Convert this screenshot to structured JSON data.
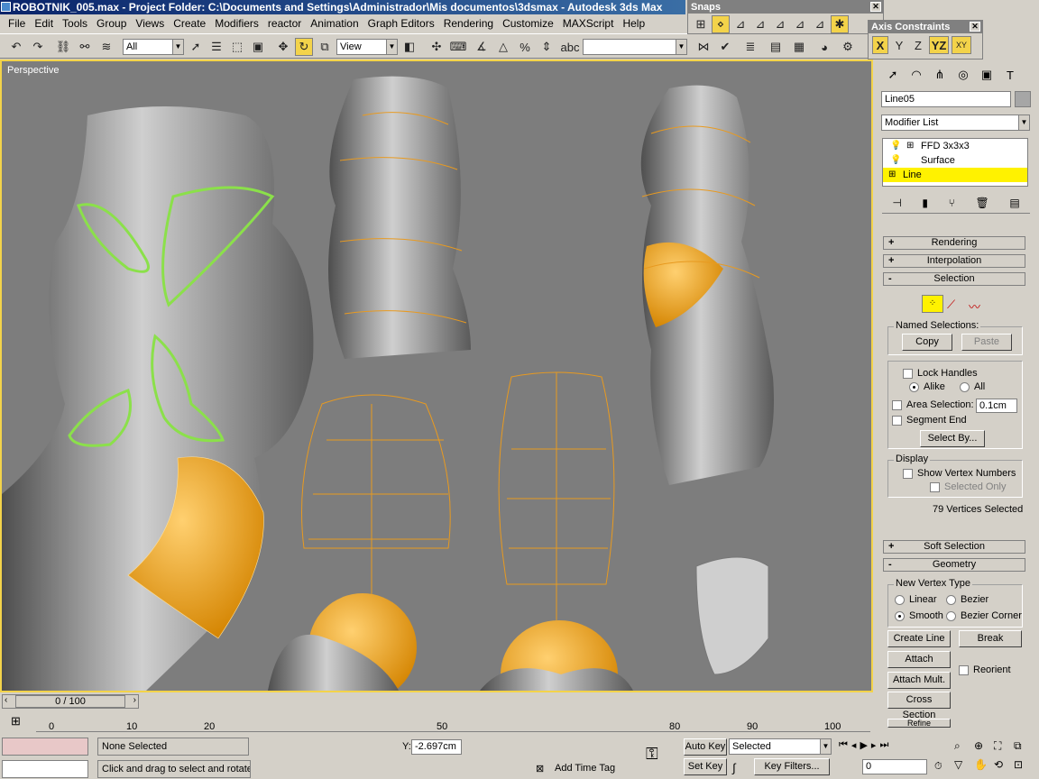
{
  "window": {
    "title": "ROBOTNIK_005.max    - Project Folder: C:\\Documents and Settings\\Administrador\\Mis documentos\\3dsmax    - Autodesk 3ds Max"
  },
  "menu": [
    "File",
    "Edit",
    "Tools",
    "Group",
    "Views",
    "Create",
    "Modifiers",
    "reactor",
    "Animation",
    "Graph Editors",
    "Rendering",
    "Customize",
    "MAXScript",
    "Help"
  ],
  "toolbar": {
    "selection_filter": "All",
    "reference_coord": "View",
    "named_selection": ""
  },
  "snaps": {
    "title": "Snaps"
  },
  "axis_constraints": {
    "title": "Axis Constraints",
    "x": "X",
    "y": "Y",
    "z": "Z",
    "yz": "YZ",
    "xy": "XY"
  },
  "viewport": {
    "label": "Perspective"
  },
  "command_panel": {
    "object_name": "Line05",
    "modifier_list": "Modifier List",
    "stack": [
      {
        "label": "FFD 3x3x3"
      },
      {
        "label": "Surface"
      },
      {
        "label": "Line"
      }
    ],
    "rollouts": {
      "rendering": "Rendering",
      "interpolation": "Interpolation",
      "selection": "Selection",
      "soft_selection": "Soft Selection",
      "geometry": "Geometry"
    },
    "named_selections": {
      "label": "Named Selections:",
      "copy": "Copy",
      "paste": "Paste"
    },
    "lock_handles": "Lock Handles",
    "alike": "Alike",
    "all": "All",
    "area_selection": "Area Selection:",
    "area_value": "0.1cm",
    "segment_end": "Segment End",
    "select_by": "Select By...",
    "display": {
      "label": "Display",
      "show_vertex_numbers": "Show Vertex Numbers",
      "selected_only": "Selected Only"
    },
    "vertices_selected": "79 Vertices Selected",
    "new_vertex_type": {
      "label": "New Vertex Type",
      "linear": "Linear",
      "bezier": "Bezier",
      "smooth": "Smooth",
      "bezier_corner": "Bezier Corner"
    },
    "create_line": "Create Line",
    "break": "Break",
    "attach": "Attach",
    "reorient": "Reorient",
    "attach_mult": "Attach Mult.",
    "cross_section": "Cross Section",
    "refine": "Refine"
  },
  "timeline": {
    "frame": "0 / 100",
    "ticks": [
      "0",
      "10",
      "20",
      "50",
      "80",
      "90",
      "100"
    ]
  },
  "status": {
    "selection": "None Selected",
    "prompt": "Click and drag to select and rotate o",
    "y_label": "Y:",
    "y_value": "-2.697cm",
    "add_time_tag": "Add Time Tag",
    "auto_key": "Auto Key",
    "set_key": "Set Key",
    "key_mode": "Selected",
    "key_filters": "Key Filters...",
    "frame_field": "0"
  }
}
